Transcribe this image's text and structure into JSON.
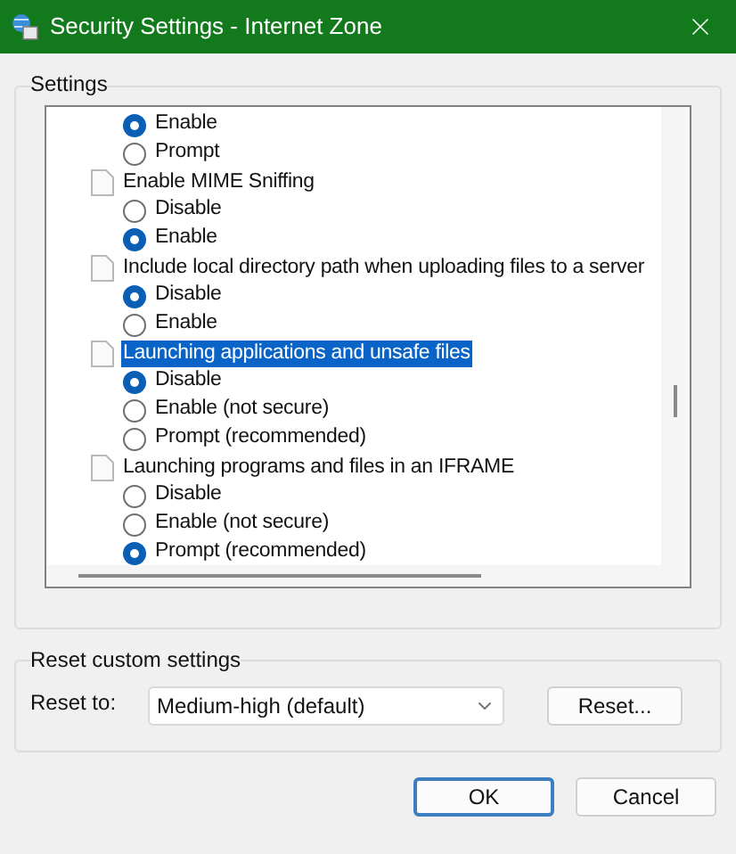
{
  "window": {
    "title": "Security Settings - Internet Zone"
  },
  "settings": {
    "legend": "Settings",
    "rows": [
      {
        "kind": "option",
        "label": "Enable",
        "selected": true
      },
      {
        "kind": "option",
        "label": "Prompt",
        "selected": false
      },
      {
        "kind": "heading",
        "label": "Enable MIME Sniffing",
        "selected": false
      },
      {
        "kind": "option",
        "label": "Disable",
        "selected": false
      },
      {
        "kind": "option",
        "label": "Enable",
        "selected": true
      },
      {
        "kind": "heading",
        "label": "Include local directory path when uploading files to a server",
        "selected": false
      },
      {
        "kind": "option",
        "label": "Disable",
        "selected": true
      },
      {
        "kind": "option",
        "label": "Enable",
        "selected": false
      },
      {
        "kind": "heading",
        "label": "Launching applications and unsafe files",
        "selected": true
      },
      {
        "kind": "option",
        "label": "Disable",
        "selected": true
      },
      {
        "kind": "option",
        "label": "Enable (not secure)",
        "selected": false
      },
      {
        "kind": "option",
        "label": "Prompt (recommended)",
        "selected": false
      },
      {
        "kind": "heading",
        "label": "Launching programs and files in an IFRAME",
        "selected": false
      },
      {
        "kind": "option",
        "label": "Disable",
        "selected": false
      },
      {
        "kind": "option",
        "label": "Enable (not secure)",
        "selected": false
      },
      {
        "kind": "option",
        "label": "Prompt (recommended)",
        "selected": true
      }
    ]
  },
  "reset": {
    "legend": "Reset custom settings",
    "label": "Reset to:",
    "value": "Medium-high (default)",
    "button": "Reset..."
  },
  "buttons": [
    {
      "label": "OK",
      "default": true
    },
    {
      "label": "Cancel",
      "default": false
    }
  ]
}
